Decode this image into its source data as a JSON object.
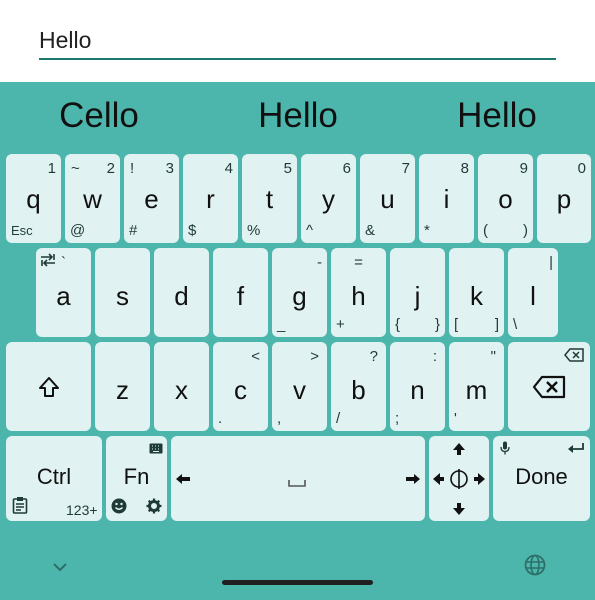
{
  "input": {
    "value": "Hello"
  },
  "suggestions": [
    "Cello",
    "Hello",
    "Hello"
  ],
  "row1": [
    {
      "main": "q",
      "hint_tr": "1",
      "hint_bl": "Esc"
    },
    {
      "main": "w",
      "hint_tl": "~",
      "hint_tr": "2",
      "hint_bl": "@"
    },
    {
      "main": "e",
      "hint_tl": "!",
      "hint_tr": "3",
      "hint_bl": "#"
    },
    {
      "main": "r",
      "hint_tr": "4",
      "hint_bl": "$"
    },
    {
      "main": "t",
      "hint_tr": "5",
      "hint_bl": "%"
    },
    {
      "main": "y",
      "hint_tr": "6",
      "hint_bl": "^"
    },
    {
      "main": "u",
      "hint_tr": "7",
      "hint_bl": "&"
    },
    {
      "main": "i",
      "hint_tr": "8",
      "hint_bl": "*"
    },
    {
      "main": "o",
      "hint_tr": "9",
      "hint_bl": "(",
      "hint_br": ")"
    },
    {
      "main": "p",
      "hint_tr": "0"
    }
  ],
  "row2": [
    {
      "main": "a",
      "hint_tc": "`"
    },
    {
      "main": "s"
    },
    {
      "main": "d"
    },
    {
      "main": "f"
    },
    {
      "main": "g",
      "hint_tr": "-",
      "hint_bl": "_"
    },
    {
      "main": "h",
      "hint_tc": "=",
      "hint_bl": "+"
    },
    {
      "main": "j",
      "hint_bl": "{",
      "hint_br": "}"
    },
    {
      "main": "k",
      "hint_bl": "[",
      "hint_br": "]"
    },
    {
      "main": "l",
      "hint_tr": "|",
      "hint_bl": "\\"
    }
  ],
  "row3": [
    {
      "main": "z"
    },
    {
      "main": "x"
    },
    {
      "main": "c",
      "hint_tr": "<",
      "hint_bl": "."
    },
    {
      "main": "v",
      "hint_tr": ">",
      "hint_bl": ","
    },
    {
      "main": "b",
      "hint_tr": "?",
      "hint_bl": "/"
    },
    {
      "main": "n",
      "hint_tr": ":",
      "hint_bl": ";"
    },
    {
      "main": "m",
      "hint_tr": "\"",
      "hint_bl": "'"
    }
  ],
  "row4": {
    "ctrl": "Ctrl",
    "fn": "Fn",
    "fn_sub": "123+",
    "done": "Done"
  },
  "icons": {
    "shift": "shift-icon",
    "backspace": "backspace-icon",
    "space": "space-icon",
    "arrows": "arrow-keys-icon",
    "clipboard": "clipboard-icon",
    "emoji": "emoji-icon",
    "settings": "gear-icon",
    "keyboard": "keyboard-icon",
    "mic": "mic-icon",
    "enter": "enter-icon",
    "collapse": "chevron-down-icon",
    "language": "globe-icon"
  },
  "colors": {
    "keyboard_bg": "#4db6ac",
    "key_bg": "#e0f2f1",
    "field_underline": "#1b7a6e"
  }
}
